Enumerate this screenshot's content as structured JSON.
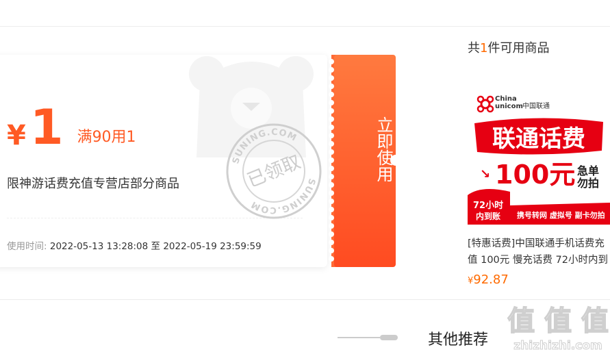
{
  "coupon": {
    "currency": "¥",
    "amount": "1",
    "condition": "满90用1",
    "scope": "限神游话费充值专营店部分商品",
    "time_label": "使用时间:",
    "time_start": "2022-05-13 13:28:08",
    "time_sep": "至",
    "time_end": "2022-05-19 23:59:59",
    "use_button": "立即使用",
    "stamp_text": "已领取",
    "stamp_ring": "SUNING.COM"
  },
  "products_panel": {
    "prefix": "共",
    "count": "1",
    "suffix": "件可用商品",
    "product": {
      "name": "[特惠话费]中国联通手机话费充值 100元 慢充话费 72小时内到",
      "currency": "¥",
      "price": "92.87",
      "image": {
        "brand_en_1": "China",
        "brand_en_2": "unicom",
        "brand_cn": "中国联通",
        "headline": "联通话费",
        "value": "100元",
        "note_1": "急单",
        "note_2": "勿拍",
        "badge_1": "72小时",
        "badge_2": "内到账",
        "footer": "携号转网 虚拟号 副卡勿拍"
      }
    }
  },
  "recommend": {
    "title": "其他推荐"
  },
  "watermark": {
    "text": "值 值 值",
    "site": "zhizhizhi.com"
  },
  "colors": {
    "accent": "#ff5a24",
    "price": "#ff6a00",
    "unicom_red": "#e60012"
  }
}
